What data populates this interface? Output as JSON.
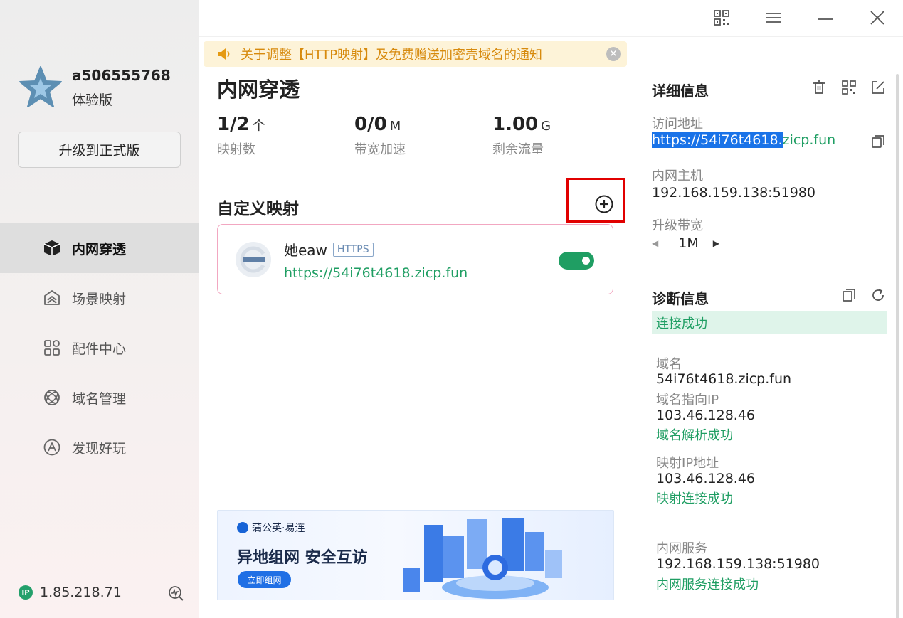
{
  "user": {
    "name": "a506555768",
    "plan": "体验版",
    "upgrade_label": "升级到正式版"
  },
  "nav": {
    "items": [
      {
        "label": "内网穿透",
        "icon": "cube-icon",
        "active": true
      },
      {
        "label": "场景映射",
        "icon": "scene-icon"
      },
      {
        "label": "配件中心",
        "icon": "apps-grid-icon"
      },
      {
        "label": "域名管理",
        "icon": "atom-icon"
      },
      {
        "label": "发现好玩",
        "icon": "compass-icon"
      }
    ]
  },
  "footer": {
    "ip_badge": "IP",
    "ip": "1.85.218.71"
  },
  "notice": {
    "text": "关于调整【HTTP映射】及免费赠送加密壳域名的通知"
  },
  "main": {
    "title": "内网穿透",
    "stats": [
      {
        "value": "1/2",
        "unit": "个",
        "label": "映射数"
      },
      {
        "value": "0/0",
        "unit": "M",
        "label": "带宽加速"
      },
      {
        "value": "1.00",
        "unit": "G",
        "label": "剩余流量"
      }
    ],
    "section_title": "自定义映射",
    "mapping": {
      "name": "她eaw",
      "protocol": "HTTPS",
      "url": "https://54i76t4618.zicp.fun",
      "enabled": true
    }
  },
  "banner": {
    "brand": "蒲公英·易连",
    "headline": "异地组网  安全互访",
    "cta": "立即组网"
  },
  "details": {
    "title": "详细信息",
    "access_label": "访问地址",
    "access_url_selected": "https://54i76t4618.",
    "access_url_rest": "zicp.fun",
    "host_label": "内网主机",
    "host_value": "192.168.159.138:51980",
    "bandwidth_label": "升级带宽",
    "bandwidth_value": "1M"
  },
  "diagnosis": {
    "title": "诊断信息",
    "status": "连接成功",
    "domain_label": "域名",
    "domain_value": "54i76t4618.zicp.fun",
    "domain_ip_label": "域名指向IP",
    "domain_ip_value": "103.46.128.46",
    "domain_resolve": "域名解析成功",
    "map_ip_label": "映射IP地址",
    "map_ip_value": "103.46.128.46",
    "map_conn": "映射连接成功",
    "service_label": "内网服务",
    "service_value": "192.168.159.138:51980",
    "service_conn": "内网服务连接成功"
  },
  "colors": {
    "green": "#1f9e63",
    "notice_bg": "#fdf3d8",
    "notice_text": "#d78a0d",
    "highlight": "#e10000"
  }
}
